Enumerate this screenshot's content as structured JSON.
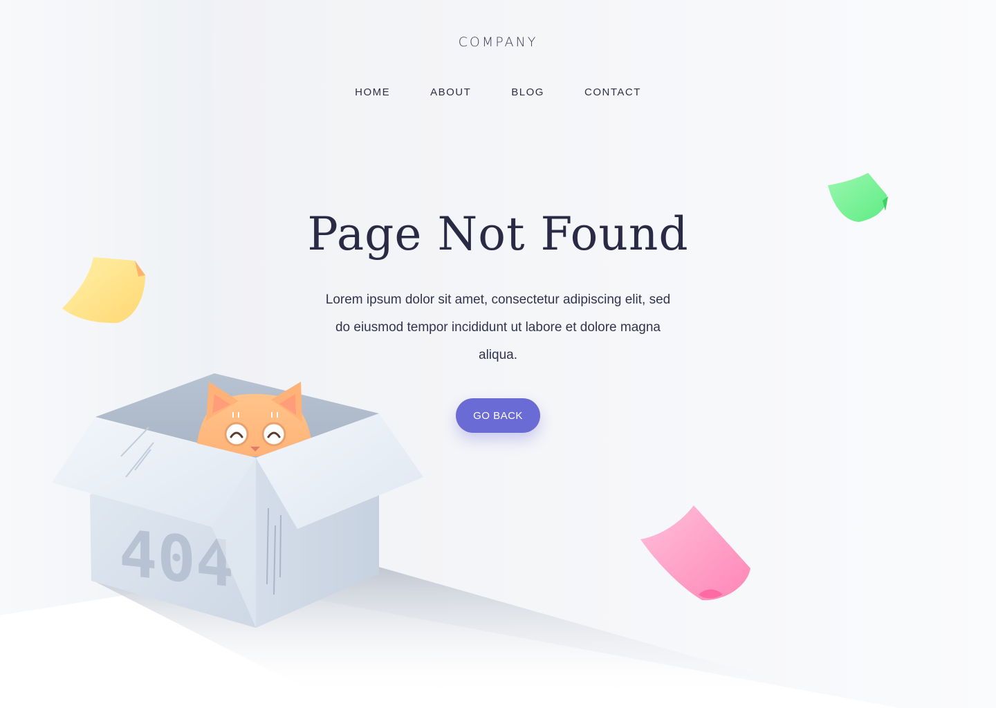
{
  "header": {
    "logo": "COMPANY",
    "nav": [
      {
        "label": "HOME"
      },
      {
        "label": "ABOUT"
      },
      {
        "label": "BLOG"
      },
      {
        "label": "CONTACT"
      }
    ]
  },
  "main": {
    "title": "Page Not Found",
    "description": "Lorem ipsum dolor sit amet, consectetur adipiscing elit, sed do eiusmod tempor incididunt ut labore et dolore magna aliqua.",
    "button_label": "GO BACK",
    "box_label": "404"
  },
  "colors": {
    "accent": "#6b6bd6",
    "text": "#2a2a45",
    "note_yellow": "#ffe08a",
    "note_green": "#7ff59a",
    "note_pink": "#ff9ec4",
    "cat": "#ffba7a"
  },
  "icons": [
    "cat-illustration",
    "cardboard-box",
    "sticky-note-yellow",
    "sticky-note-green",
    "sticky-note-pink"
  ]
}
